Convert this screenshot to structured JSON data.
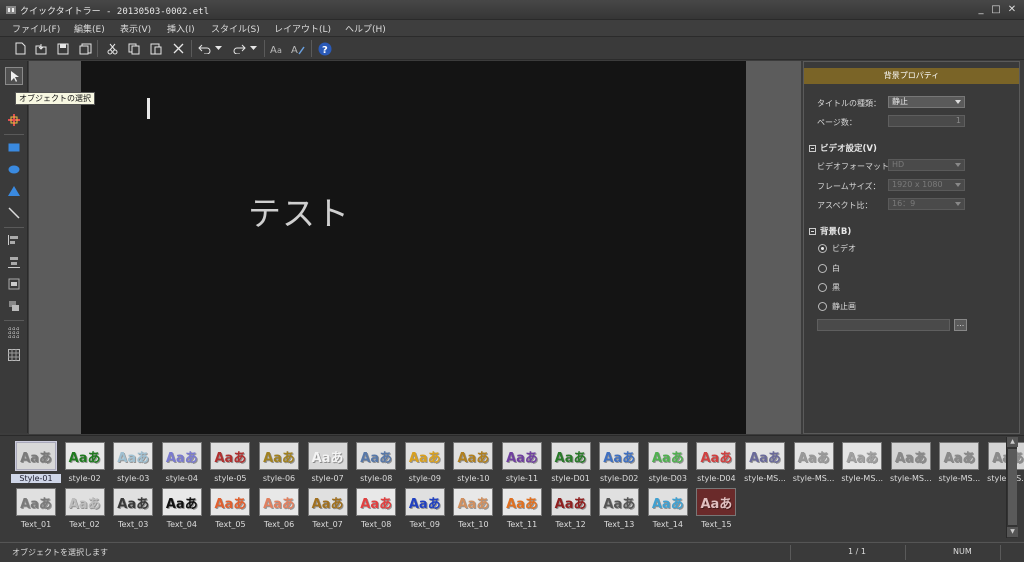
{
  "window": {
    "title": "クイックタイトラー - 20130503-0002.etl",
    "minimize": "_",
    "maximize": "□",
    "close": "✕"
  },
  "menubar": [
    {
      "label": "ファイル(F)"
    },
    {
      "label": "編集(E)"
    },
    {
      "label": "表示(V)"
    },
    {
      "label": "挿入(I)"
    },
    {
      "label": "スタイル(S)"
    },
    {
      "label": "レイアウト(L)"
    },
    {
      "label": "ヘルプ(H)"
    }
  ],
  "toolbar": {
    "help": "?"
  },
  "tooltip": "オブジェクトの選択",
  "canvas": {
    "text": "テスト",
    "background": "#141414"
  },
  "panel": {
    "title": "背景プロパティ",
    "title_color": "#7a6427",
    "title_type_label": "タイトルの種類：",
    "title_type_value": "静止",
    "page_count_label": "ページ数：",
    "page_count_value": "1",
    "video_section": "ビデオ設定(V)",
    "video_format_label": "ビデオフォーマット：",
    "video_format_value": "HD",
    "frame_size_label": "フレームサイズ：",
    "frame_size_value": "1920 x 1080",
    "aspect_label": "アスペクト比：",
    "aspect_value": "16：9",
    "bg_section": "背景(B)",
    "bg_options": [
      {
        "label": "ビデオ",
        "selected": true
      },
      {
        "label": "白",
        "selected": false
      },
      {
        "label": "黒",
        "selected": false
      },
      {
        "label": "静止画",
        "selected": false
      }
    ],
    "browse": "..."
  },
  "styles": [
    {
      "label": "Style-01",
      "glyph": "Aaあ",
      "bg": "#d8d8d8",
      "fg": "#7a7a7a"
    },
    {
      "label": "style-02",
      "glyph": "Aaあ",
      "bg": "#e8e8e8",
      "fg": "#1f7a1f"
    },
    {
      "label": "style-03",
      "glyph": "Aaあ",
      "bg": "#e6e6e6",
      "fg": "#9fbfd0"
    },
    {
      "label": "style-04",
      "glyph": "Aaあ",
      "bg": "#e0e0e0",
      "fg": "#7a7ad0"
    },
    {
      "label": "style-05",
      "glyph": "Aaあ",
      "bg": "#e0e0e0",
      "fg": "#b03030"
    },
    {
      "label": "style-06",
      "glyph": "Aaあ",
      "bg": "#e0e0e0",
      "fg": "#a08020"
    },
    {
      "label": "style-07",
      "glyph": "Aaあ",
      "bg": "#d8d8d8",
      "fg": "#f4f4f4"
    },
    {
      "label": "style-08",
      "glyph": "Aaあ",
      "bg": "#e0e0e0",
      "fg": "#5878a8"
    },
    {
      "label": "style-09",
      "glyph": "Aaあ",
      "bg": "#e0e0e0",
      "fg": "#d8a020"
    },
    {
      "label": "style-10",
      "glyph": "Aaあ",
      "bg": "#e0e0e0",
      "fg": "#b08020"
    },
    {
      "label": "style-11",
      "glyph": "Aaあ",
      "bg": "#e0e0e0",
      "fg": "#7040a0"
    },
    {
      "label": "style-D01",
      "glyph": "Aaあ",
      "bg": "#e0e0e0",
      "fg": "#2a7a2a"
    },
    {
      "label": "style-D02",
      "glyph": "Aaあ",
      "bg": "#e0e0e0",
      "fg": "#4070c0"
    },
    {
      "label": "style-D03",
      "glyph": "Aaあ",
      "bg": "#e0e0e0",
      "fg": "#50b050"
    },
    {
      "label": "style-D04",
      "glyph": "Aaあ",
      "bg": "#e0e0e0",
      "fg": "#d04040"
    },
    {
      "label": "style-MS...",
      "glyph": "Aaあ",
      "bg": "#e4e4e4",
      "fg": "#6a6a9a"
    },
    {
      "label": "style-MS...",
      "glyph": "Aaあ",
      "bg": "#e4e4e4",
      "fg": "#9a9a9a"
    },
    {
      "label": "style-MS...",
      "glyph": "Aaあ",
      "bg": "#e4e4e4",
      "fg": "#a0a0a0"
    },
    {
      "label": "style-MS...",
      "glyph": "Aaあ",
      "bg": "#d4d4d4",
      "fg": "#8a8a8a"
    },
    {
      "label": "style-MS...",
      "glyph": "Aaあ",
      "bg": "#d4d4d4",
      "fg": "#8a8a8a"
    },
    {
      "label": "style-MS...",
      "glyph": "Aaあ",
      "bg": "#d4d4d4",
      "fg": "#8a8a8a"
    },
    {
      "label": "Text_01",
      "glyph": "Aaあ",
      "bg": "#e0e0e0",
      "fg": "#7a7a7a"
    },
    {
      "label": "Text_02",
      "glyph": "Aaあ",
      "bg": "#e0e0e0",
      "fg": "#bdbdbd"
    },
    {
      "label": "Text_03",
      "glyph": "Aaあ",
      "bg": "#e0e0e0",
      "fg": "#3a3a3a"
    },
    {
      "label": "Text_04",
      "glyph": "Aaあ",
      "bg": "#e8e8e8",
      "fg": "#111111"
    },
    {
      "label": "Text_05",
      "glyph": "Aaあ",
      "bg": "#e8e8e8",
      "fg": "#e06030"
    },
    {
      "label": "Text_06",
      "glyph": "Aaあ",
      "bg": "#e8e8e8",
      "fg": "#e08060"
    },
    {
      "label": "Text_07",
      "glyph": "Aaあ",
      "bg": "#e0e0e0",
      "fg": "#a07020"
    },
    {
      "label": "Text_08",
      "glyph": "Aaあ",
      "bg": "#e8e8e8",
      "fg": "#e04040"
    },
    {
      "label": "Text_09",
      "glyph": "Aaあ",
      "bg": "#e0e0e0",
      "fg": "#2040c0"
    },
    {
      "label": "Text_10",
      "glyph": "Aaあ",
      "bg": "#e8e8e8",
      "fg": "#d09060"
    },
    {
      "label": "Text_11",
      "glyph": "Aaあ",
      "bg": "#e8e8e8",
      "fg": "#e07020"
    },
    {
      "label": "Text_12",
      "glyph": "Aaあ",
      "bg": "#e0e0e0",
      "fg": "#902020"
    },
    {
      "label": "Text_13",
      "glyph": "Aaあ",
      "bg": "#e0e0e0",
      "fg": "#555555"
    },
    {
      "label": "Text_14",
      "glyph": "Aaあ",
      "bg": "#e0e0e0",
      "fg": "#40a0d0"
    },
    {
      "label": "Text_15",
      "glyph": "Aaあ",
      "bg": "#6a2a2a",
      "fg": "#e0c0c0"
    }
  ],
  "status": {
    "message": "オブジェクトを選択します",
    "page": "1 / 1",
    "num": "NUM"
  }
}
